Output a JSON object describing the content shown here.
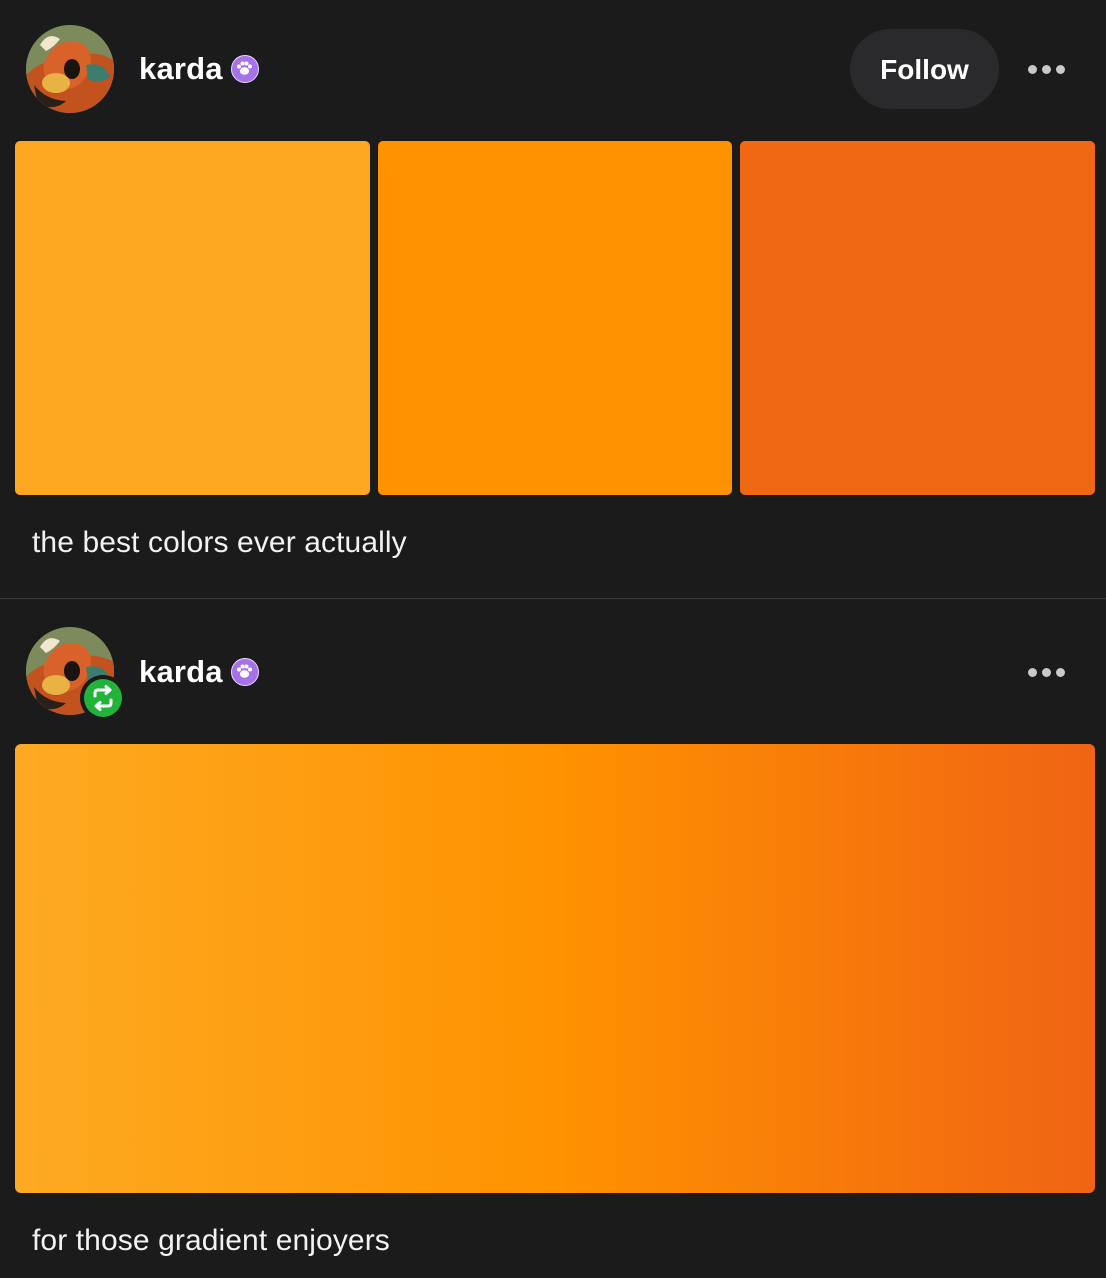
{
  "colors": {
    "background": "#1b1b1c",
    "swatch_1": "#fca71f",
    "swatch_2": "#ff9200",
    "swatch_3": "#f06814",
    "gradient_start": "#fdaa22",
    "gradient_mid": "#ff9200",
    "gradient_end": "#f06414",
    "reblog_green": "#22b43a",
    "badge_purple": "#a772e8"
  },
  "post1": {
    "username": "karda",
    "badge_icon": "paw-icon",
    "follow_label": "Follow",
    "more_icon": "more-options-icon",
    "caption": "the best colors ever actually"
  },
  "post2": {
    "username": "karda",
    "badge_icon": "paw-icon",
    "reblog_icon": "reblog-icon",
    "more_icon": "more-options-icon",
    "caption": "for those gradient enjoyers"
  }
}
